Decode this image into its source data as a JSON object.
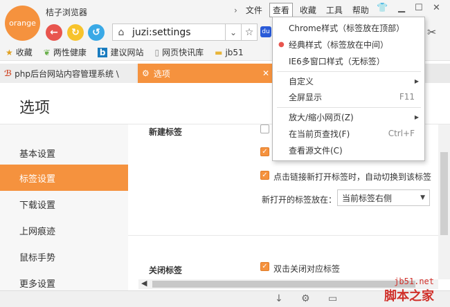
{
  "app": {
    "logo_text": "orange",
    "title": "桔子浏览器"
  },
  "menu": {
    "items": [
      "文件",
      "查看",
      "收藏",
      "工具",
      "帮助"
    ],
    "active_index": 1
  },
  "address": {
    "url": "juzi:settings"
  },
  "bookmarks": [
    {
      "label": "收藏",
      "icon": "star-icon"
    },
    {
      "label": "两性健康",
      "icon": "leaf-icon"
    },
    {
      "label": "建议网站",
      "icon": "bing-icon"
    },
    {
      "label": "网页快讯库",
      "icon": "page-icon"
    },
    {
      "label": "jb51",
      "icon": "folder-icon"
    }
  ],
  "tabs": [
    {
      "label": "php后台网站内容管理系统 \\",
      "active": false
    },
    {
      "label": "选项",
      "active": true
    }
  ],
  "page": {
    "title": "选项",
    "sidebar": [
      "基本设置",
      "标签设置",
      "下载设置",
      "上网痕迹",
      "鼠标手势",
      "更多设置"
    ],
    "sidebar_active_index": 1,
    "sections": {
      "new_tab_label": "新建标签",
      "close_tab_label": "关闭标签"
    },
    "options": {
      "auto_switch": "点击链接新打开标签时，自动切换到该标签",
      "new_tab_position_label": "新打开的标签放在：",
      "new_tab_position_value": "当前标签右侧",
      "dblclick_close": "双击关闭对应标签"
    }
  },
  "dropdown": {
    "items": [
      {
        "label": "Chrome样式（标签放在顶部）",
        "bullet": false
      },
      {
        "label": "经典样式（标签放在中间）",
        "bullet": true
      },
      {
        "label": "IE6多窗口样式（无标签）",
        "bullet": false
      },
      {
        "label": "自定义",
        "submenu": true
      },
      {
        "label": "全屏显示",
        "shortcut": "F11"
      },
      {
        "label": "放大/缩小网页(Z)",
        "submenu": true
      },
      {
        "label": "在当前页查找(F)",
        "shortcut": "Ctrl+F"
      },
      {
        "label": "查看源文件(C)"
      }
    ]
  },
  "watermark": {
    "line1": "jb51.net",
    "line2": "脚本之家"
  },
  "colors": {
    "accent": "#f5923e",
    "bullet": "#e8554e",
    "watermark": "#d0302a"
  }
}
